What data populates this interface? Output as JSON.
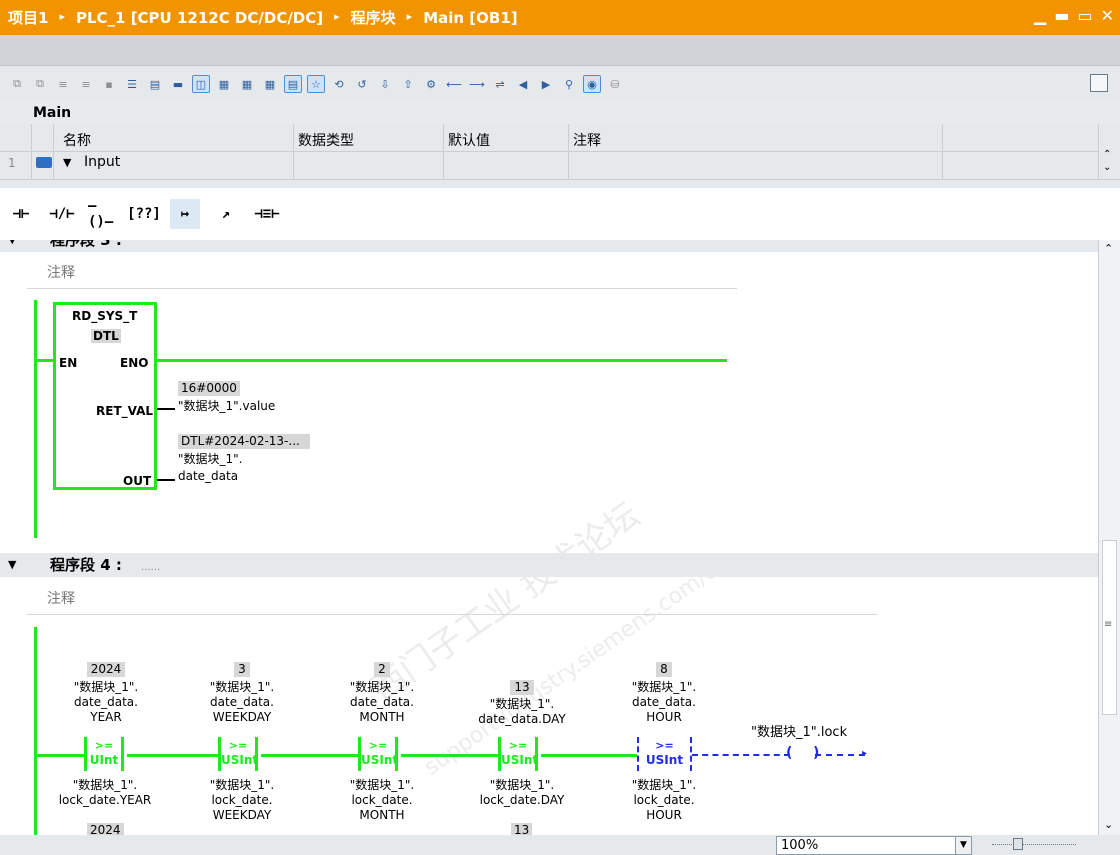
{
  "title": {
    "crumbs": [
      "项目1",
      "PLC_1 [CPU 1212C DC/DC/DC]",
      "程序块",
      "Main [OB1]"
    ],
    "separator": "▸",
    "controls": [
      "▁",
      "▬",
      "▭",
      "✕"
    ]
  },
  "interface": {
    "block_name": "Main",
    "headers": {
      "name": "名称",
      "datatype": "数据类型",
      "default": "默认值",
      "comment": "注释"
    },
    "row": {
      "num": "1",
      "expand": "▼",
      "name": "Input"
    }
  },
  "ladder_toolbar": [
    "⊣⊢",
    "⊣/⊢",
    "–()–",
    "[??]",
    "↦",
    "↗",
    "⊣≡⊢"
  ],
  "networks": [
    {
      "caret": "▼",
      "title": "程序段 3 :",
      "comment": "注释"
    },
    {
      "caret": "▼",
      "title": "程序段 4 :",
      "comment": "注释",
      "dots": "......"
    }
  ],
  "rd_sys_t": {
    "name": "RD_SYS_T",
    "type": "DTL",
    "en": "EN",
    "eno": "ENO",
    "ret_val": "RET_VAL",
    "out": "OUT",
    "ret_val_value": "16#0000",
    "ret_val_tag": "\"数据块_1\".value",
    "out_value": "DTL#2024-02-13-...",
    "out_tag_1": "\"数据块_1\".",
    "out_tag_2": "date_data"
  },
  "comparators": [
    {
      "value": "2024",
      "in1": [
        "\"数据块_1\".",
        "date_data.",
        "YEAR"
      ],
      "op": ">=",
      "type": "UInt",
      "in2": [
        "\"数据块_1\".",
        "lock_date.YEAR"
      ],
      "in2_value": "2024"
    },
    {
      "value": "3",
      "in1": [
        "\"数据块_1\".",
        "date_data.",
        "WEEKDAY"
      ],
      "op": ">=",
      "type": "USInt",
      "in2": [
        "\"数据块_1\".",
        "lock_date.",
        "WEEKDAY"
      ]
    },
    {
      "value": "2",
      "in1": [
        "\"数据块_1\".",
        "date_data.",
        "MONTH"
      ],
      "op": ">=",
      "type": "USInt",
      "in2": [
        "\"数据块_1\".",
        "lock_date.",
        "MONTH"
      ]
    },
    {
      "value": "13",
      "in1": [
        "\"数据块_1\".",
        "date_data.DAY"
      ],
      "op": ">=",
      "type": "USInt",
      "in2": [
        "\"数据块_1\".",
        "lock_date.DAY"
      ],
      "in2_value": "13"
    },
    {
      "value": "8",
      "in1": [
        "\"数据块_1\".",
        "date_data.",
        "HOUR"
      ],
      "op": ">=",
      "type": "USInt",
      "in2": [
        "\"数据块_1\".",
        "lock_date.",
        "HOUR"
      ]
    }
  ],
  "coil": {
    "tag": "\"数据块_1\".lock"
  },
  "watermark": {
    "text1": "西门子工业 技术论坛",
    "text2": "support.industry.siemens.com/cs"
  },
  "zoom": {
    "value": "100%"
  }
}
